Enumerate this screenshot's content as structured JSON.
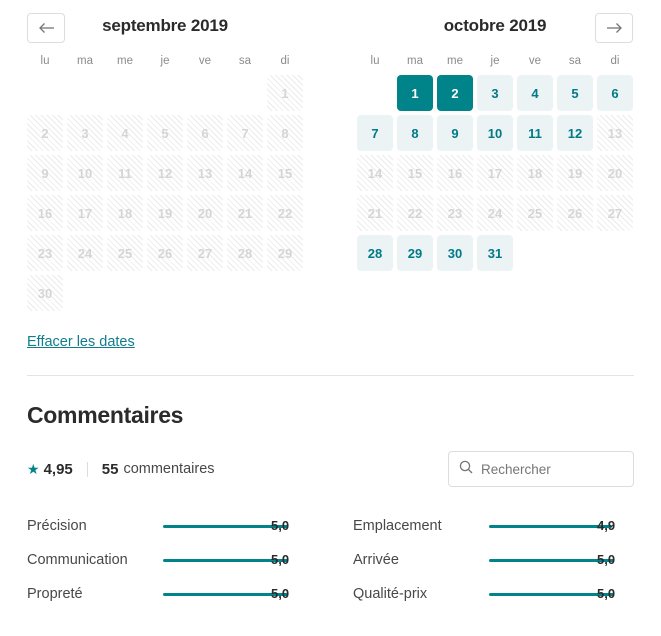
{
  "calendar": {
    "prev_button_icon": "arrow-left-icon",
    "next_button_icon": "arrow-right-icon",
    "weekdays": [
      "lu",
      "ma",
      "me",
      "je",
      "ve",
      "sa",
      "di"
    ],
    "colors": {
      "selected_bg": "#008489",
      "available_bg": "#ebf3f4",
      "available_text": "#007a87",
      "blocked_text": "#d5d5d5"
    },
    "months": [
      {
        "title": "septembre 2019",
        "lead_blanks": 6,
        "days": [
          {
            "n": "1",
            "state": "blocked"
          },
          {
            "n": "2",
            "state": "blocked"
          },
          {
            "n": "3",
            "state": "blocked"
          },
          {
            "n": "4",
            "state": "blocked"
          },
          {
            "n": "5",
            "state": "blocked"
          },
          {
            "n": "6",
            "state": "blocked"
          },
          {
            "n": "7",
            "state": "blocked"
          },
          {
            "n": "8",
            "state": "blocked"
          },
          {
            "n": "9",
            "state": "blocked"
          },
          {
            "n": "10",
            "state": "blocked"
          },
          {
            "n": "11",
            "state": "blocked"
          },
          {
            "n": "12",
            "state": "blocked"
          },
          {
            "n": "13",
            "state": "blocked"
          },
          {
            "n": "14",
            "state": "blocked"
          },
          {
            "n": "15",
            "state": "blocked"
          },
          {
            "n": "16",
            "state": "blocked"
          },
          {
            "n": "17",
            "state": "blocked"
          },
          {
            "n": "18",
            "state": "blocked"
          },
          {
            "n": "19",
            "state": "blocked"
          },
          {
            "n": "20",
            "state": "blocked"
          },
          {
            "n": "21",
            "state": "blocked"
          },
          {
            "n": "22",
            "state": "blocked"
          },
          {
            "n": "23",
            "state": "blocked"
          },
          {
            "n": "24",
            "state": "blocked"
          },
          {
            "n": "25",
            "state": "blocked"
          },
          {
            "n": "26",
            "state": "blocked"
          },
          {
            "n": "27",
            "state": "blocked"
          },
          {
            "n": "28",
            "state": "blocked"
          },
          {
            "n": "29",
            "state": "blocked"
          },
          {
            "n": "30",
            "state": "blocked"
          }
        ]
      },
      {
        "title": "octobre 2019",
        "lead_blanks": 1,
        "days": [
          {
            "n": "1",
            "state": "selected"
          },
          {
            "n": "2",
            "state": "selected"
          },
          {
            "n": "3",
            "state": "available"
          },
          {
            "n": "4",
            "state": "available"
          },
          {
            "n": "5",
            "state": "available"
          },
          {
            "n": "6",
            "state": "available"
          },
          {
            "n": "7",
            "state": "available"
          },
          {
            "n": "8",
            "state": "available"
          },
          {
            "n": "9",
            "state": "available"
          },
          {
            "n": "10",
            "state": "available"
          },
          {
            "n": "11",
            "state": "available"
          },
          {
            "n": "12",
            "state": "available"
          },
          {
            "n": "13",
            "state": "blocked"
          },
          {
            "n": "14",
            "state": "blocked"
          },
          {
            "n": "15",
            "state": "blocked"
          },
          {
            "n": "16",
            "state": "blocked"
          },
          {
            "n": "17",
            "state": "blocked"
          },
          {
            "n": "18",
            "state": "blocked"
          },
          {
            "n": "19",
            "state": "blocked"
          },
          {
            "n": "20",
            "state": "blocked"
          },
          {
            "n": "21",
            "state": "blocked"
          },
          {
            "n": "22",
            "state": "blocked"
          },
          {
            "n": "23",
            "state": "blocked"
          },
          {
            "n": "24",
            "state": "blocked"
          },
          {
            "n": "25",
            "state": "blocked"
          },
          {
            "n": "26",
            "state": "blocked"
          },
          {
            "n": "27",
            "state": "blocked"
          },
          {
            "n": "28",
            "state": "available"
          },
          {
            "n": "29",
            "state": "available"
          },
          {
            "n": "30",
            "state": "available"
          },
          {
            "n": "31",
            "state": "available"
          }
        ]
      }
    ]
  },
  "clear_dates": {
    "label": "Effacer les dates"
  },
  "reviews": {
    "title": "Commentaires",
    "star_icon": "star-icon",
    "rating": "4,95",
    "count": "55",
    "count_label": "commentaires",
    "search": {
      "icon": "search-icon",
      "placeholder": "Rechercher",
      "value": ""
    },
    "categories": [
      {
        "label": "Précision",
        "value": "5,0",
        "percent": 100
      },
      {
        "label": "Emplacement",
        "value": "4,9",
        "percent": 98
      },
      {
        "label": "Communication",
        "value": "5,0",
        "percent": 100
      },
      {
        "label": "Arrivée",
        "value": "5,0",
        "percent": 100
      },
      {
        "label": "Propreté",
        "value": "5,0",
        "percent": 100
      },
      {
        "label": "Qualité-prix",
        "value": "5,0",
        "percent": 100
      }
    ]
  }
}
